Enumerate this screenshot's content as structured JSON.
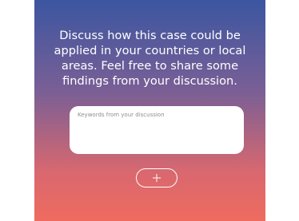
{
  "prompt": {
    "text": "Discuss how this case could be applied in your countries or local areas. Feel free to share some findings from your discussion."
  },
  "input": {
    "placeholder": "Keywords from your discussion",
    "value": ""
  },
  "add_button": {
    "icon": "plus-icon"
  },
  "colors": {
    "gradient_top": "#3b56a1",
    "gradient_bottom": "#ef6b5f",
    "text": "#ffffff",
    "input_background": "#ffffff"
  }
}
